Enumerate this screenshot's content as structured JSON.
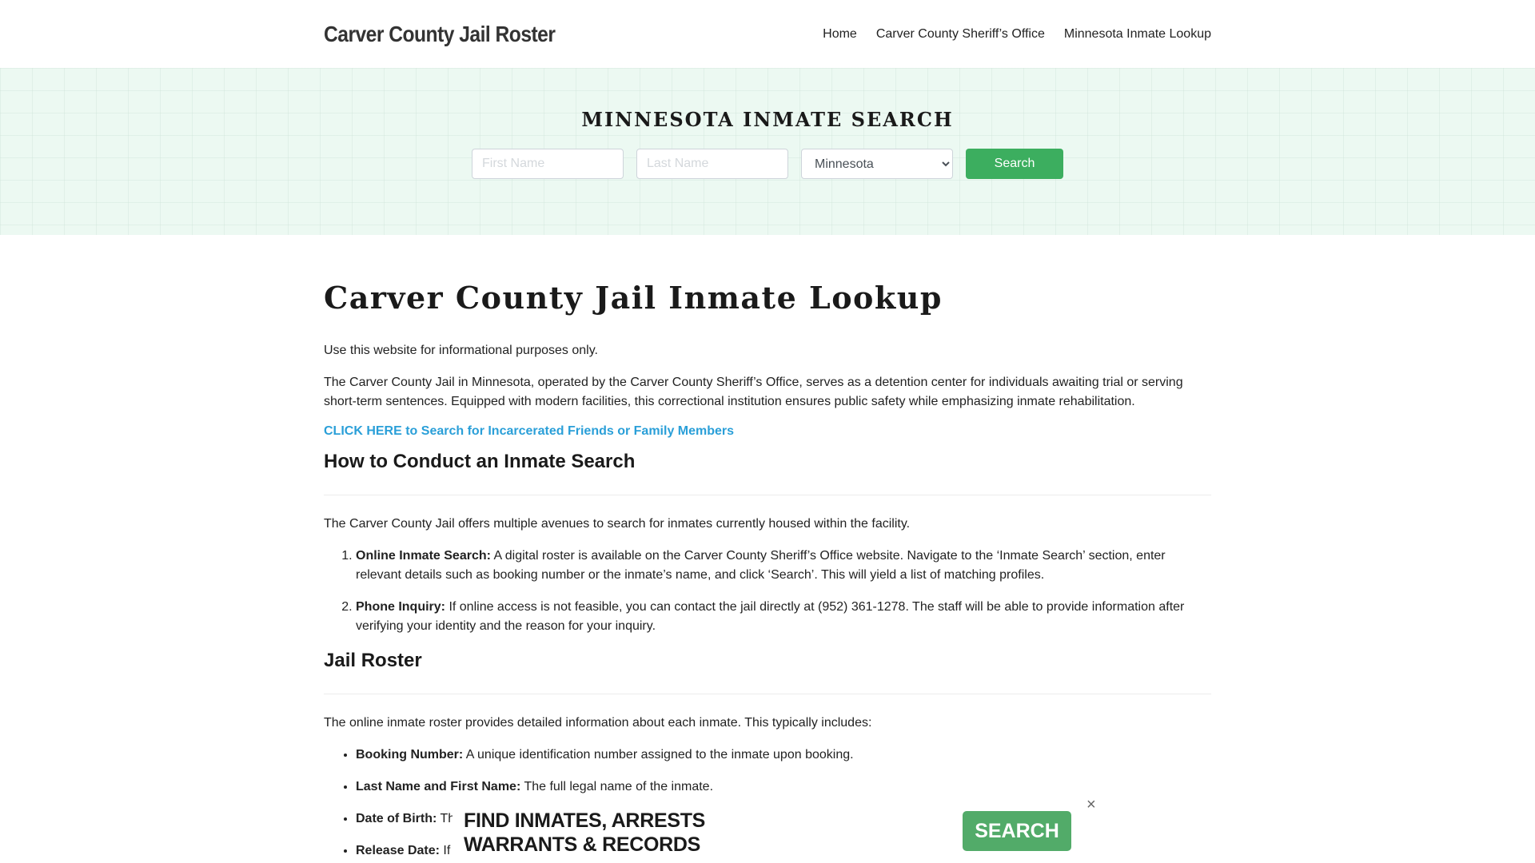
{
  "header": {
    "site_title": "Carver County Jail Roster",
    "nav": [
      {
        "label": "Home"
      },
      {
        "label": "Carver County Sheriff’s Office"
      },
      {
        "label": "Minnesota Inmate Lookup"
      }
    ]
  },
  "hero": {
    "title": "MINNESOTA INMATE SEARCH",
    "first_name_placeholder": "First Name",
    "last_name_placeholder": "Last Name",
    "state_selected": "Minnesota",
    "search_label": "Search"
  },
  "main": {
    "title": "Carver County Jail Inmate Lookup",
    "disclaimer": "Use this website for informational purposes only.",
    "intro": "The Carver County Jail in Minnesota, operated by the Carver County Sheriff’s Office, serves as a detention center for individuals awaiting trial or serving short-term sentences. Equipped with modern facilities, this correctional institution ensures public safety while emphasizing inmate rehabilitation.",
    "cta_link": "CLICK HERE to Search for Incarcerated Friends or Family Members",
    "section1": {
      "heading": "How to Conduct an Inmate Search",
      "intro": "The Carver County Jail offers multiple avenues to search for inmates currently housed within the facility.",
      "steps": [
        {
          "label": "Online Inmate Search:",
          "text": " A digital roster is available on the Carver County Sheriff’s Office website. Navigate to the ‘Inmate Search’ section, enter relevant details such as booking number or the inmate’s name, and click ‘Search’. This will yield a list of matching profiles."
        },
        {
          "label": "Phone Inquiry:",
          "text": " If online access is not feasible, you can contact the jail directly at (952) 361-1278. The staff will be able to provide information after verifying your identity and the reason for your inquiry."
        }
      ]
    },
    "section2": {
      "heading": "Jail Roster",
      "intro": "The online inmate roster provides detailed information about each inmate. This typically includes:",
      "fields": [
        {
          "label": "Booking Number:",
          "text": " A unique identification number assigned to the inmate upon booking."
        },
        {
          "label": "Last Name and First Name:",
          "text": " The full legal name of the inmate."
        },
        {
          "label": "Date of Birth:",
          "text": " Th"
        },
        {
          "label": "Release Date:",
          "text": " If"
        }
      ]
    }
  },
  "ad": {
    "line1": "FIND INMATES, ARRESTS",
    "line2": "WARRANTS & RECORDS",
    "button_label": "SEARCH",
    "close_glyph": "×",
    "accent_color": "#52ab69"
  }
}
